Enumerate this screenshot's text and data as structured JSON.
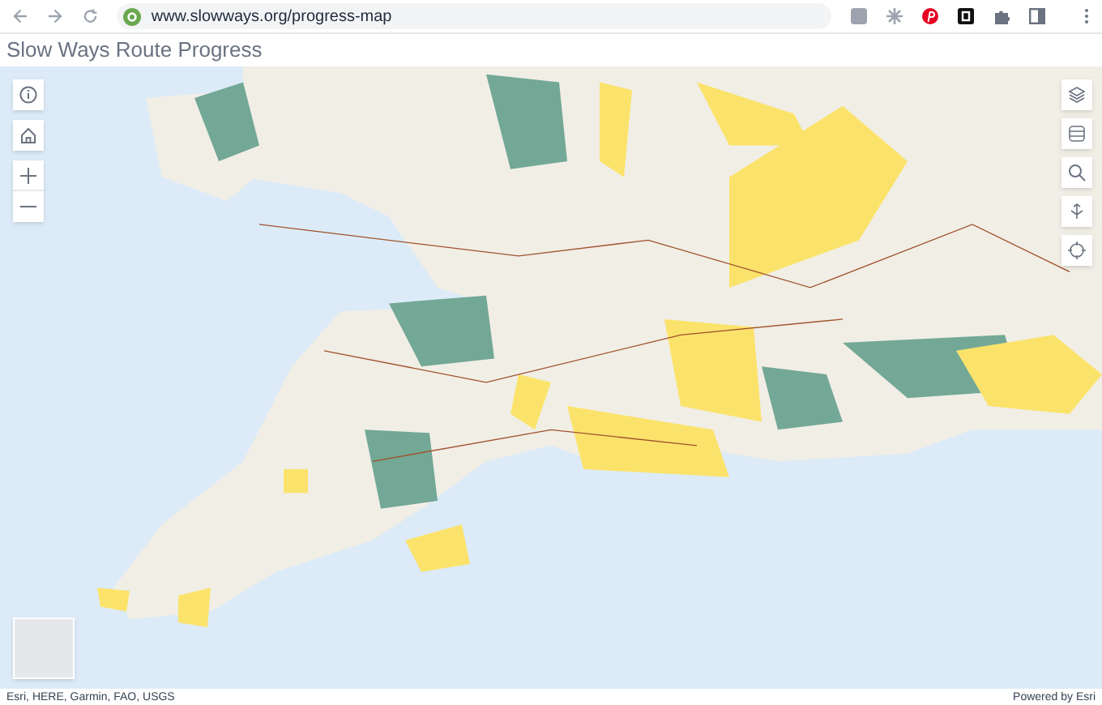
{
  "browser": {
    "url": "www.slowways.org/progress-map"
  },
  "page": {
    "title": "Slow Ways Route Progress"
  },
  "map": {
    "attribution": "Esri, HERE, Garmin, FAO, USGS",
    "powered_by": "Powered by Esri"
  }
}
